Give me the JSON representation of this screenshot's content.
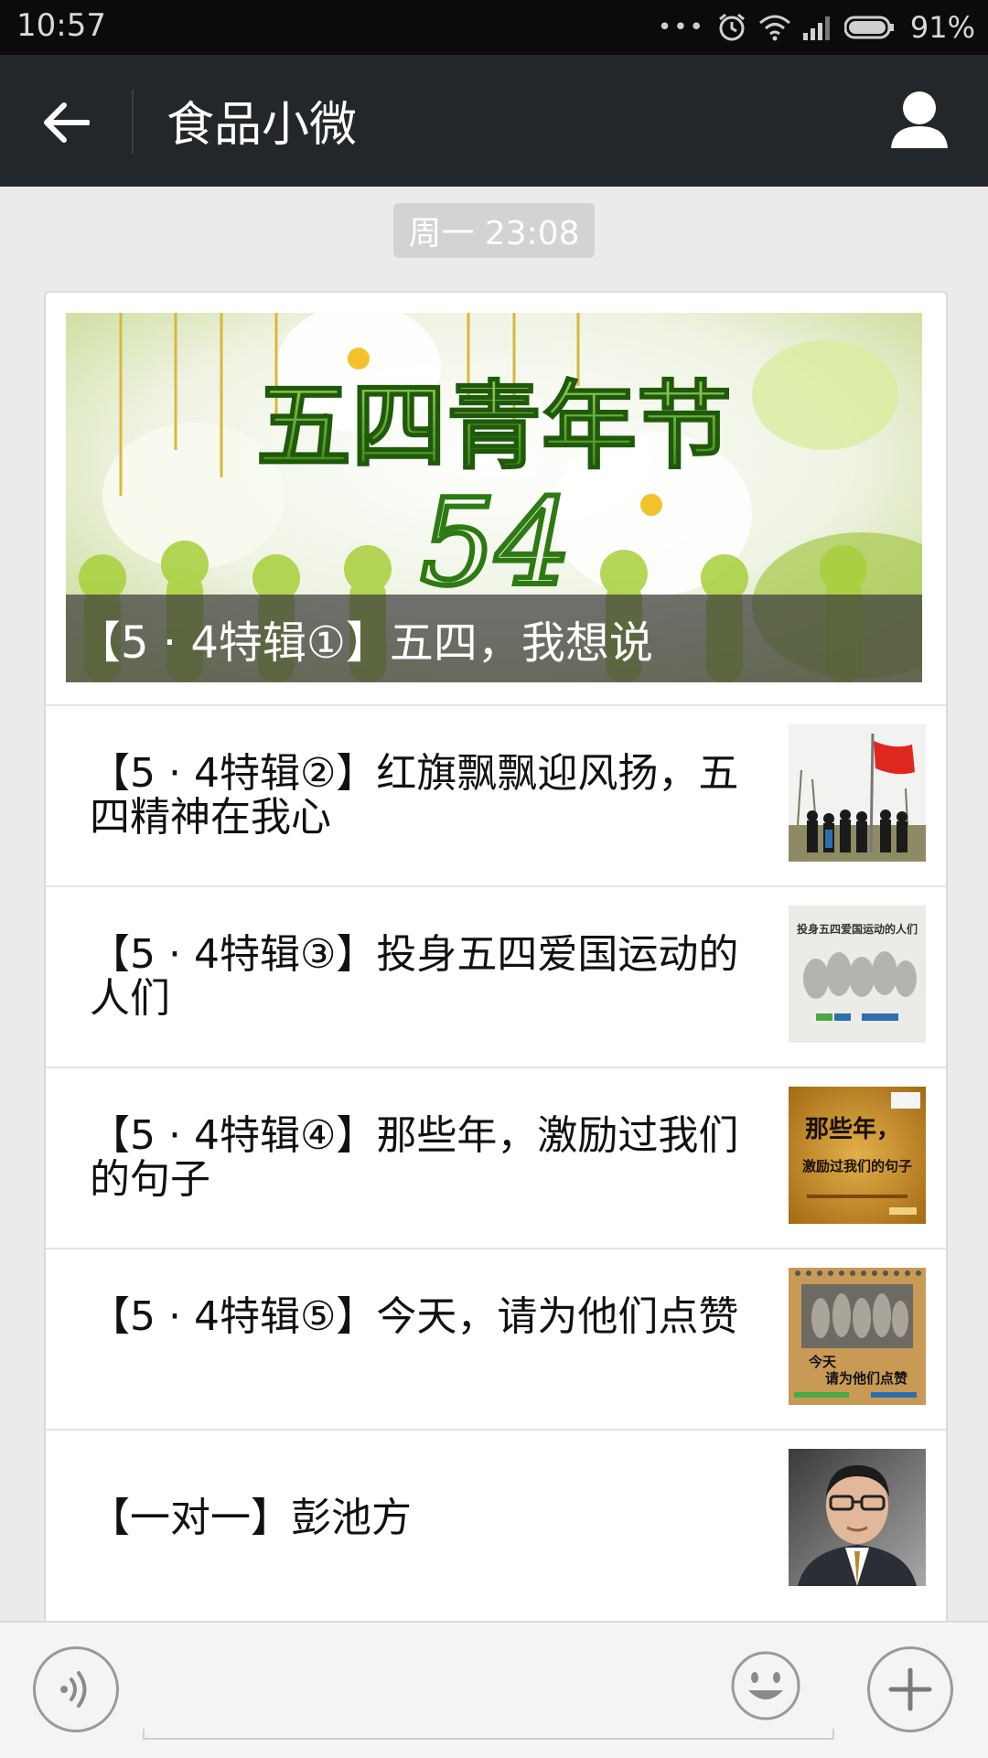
{
  "status_bar": {
    "time": "10:57",
    "battery": "91%",
    "icons": [
      "more-dots-icon",
      "alarm-icon",
      "wifi-icon",
      "signal-icon",
      "battery-icon"
    ]
  },
  "header": {
    "title": "食品小微",
    "back_icon": "back-arrow-icon",
    "profile_icon": "person-icon"
  },
  "chat": {
    "timestamp": "周一 23:08"
  },
  "news_card": {
    "lead": {
      "banner_text": "五四青年节",
      "banner_number": "54",
      "caption": "【5 · 4特辑①】五四，我想说"
    },
    "items": [
      {
        "title": "【5 · 4特辑②】红旗飘飘迎风扬，五四精神在我心",
        "thumb_icon": "flag-photo"
      },
      {
        "title": "【5 · 4特辑③】投身五四爱国运动的人们",
        "thumb_icon": "relief-poster",
        "thumb_text": "投身五四爱国运动的人们"
      },
      {
        "title": "【5 · 4特辑④】那些年，激励过我们的句子",
        "thumb_icon": "calligraphy-poster",
        "thumb_text_1": "那些年，",
        "thumb_text_2": "激励过我们的句子"
      },
      {
        "title": "【5 · 4特辑⑤】今天，请为他们点赞",
        "thumb_icon": "calendar-poster",
        "thumb_text_1": "今天",
        "thumb_text_2": "请为他们点赞"
      },
      {
        "title": "【一对一】彭池方",
        "thumb_icon": "portrait-photo"
      }
    ]
  },
  "input_bar": {
    "voice_icon": "voice-icon",
    "emoji_icon": "emoji-icon",
    "plus_icon": "plus-icon"
  },
  "colors": {
    "header_bg": "#23272a",
    "status_bg": "#0b0b0b",
    "chat_bg": "#ebebeb",
    "banner_green": "#3f8d1e"
  }
}
